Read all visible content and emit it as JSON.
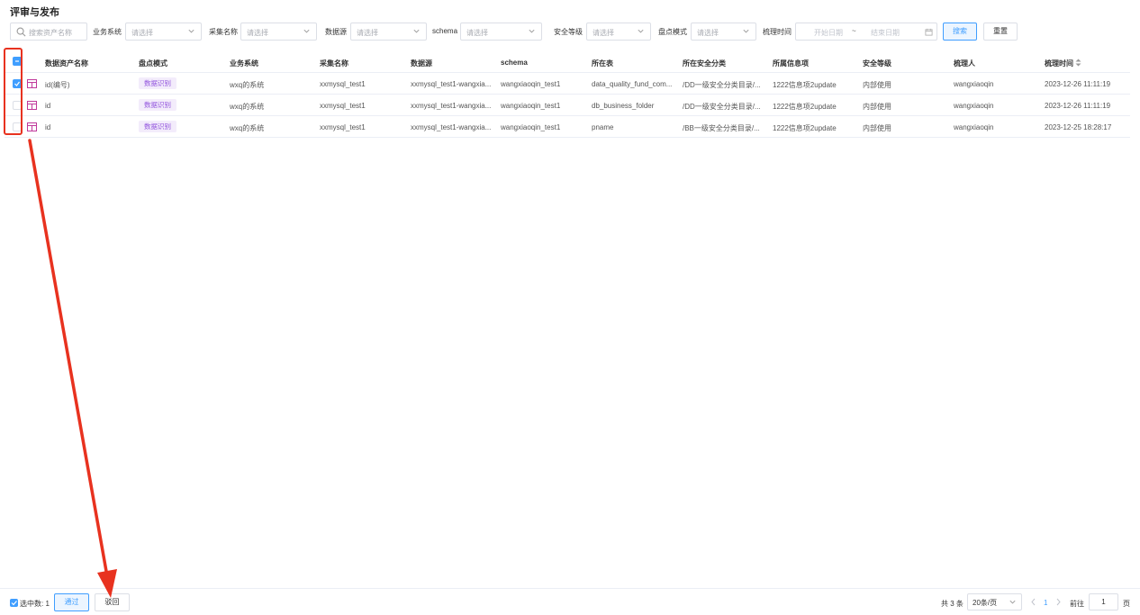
{
  "title": "评审与发布",
  "filters": {
    "search_placeholder": "搜索资产名称",
    "items": [
      {
        "label": "业务系统",
        "placeholder": "请选择"
      },
      {
        "label": "采集名称",
        "placeholder": "请选择"
      },
      {
        "label": "数据源",
        "placeholder": "请选择"
      },
      {
        "label": "schema",
        "placeholder": "请选择"
      },
      {
        "label": "安全等级",
        "placeholder": "请选择"
      },
      {
        "label": "盘点模式",
        "placeholder": "请选择"
      }
    ],
    "time_label": "梳理时间",
    "start_placeholder": "开始日期",
    "end_placeholder": "结束日期",
    "range_sep": "~",
    "search_button": "搜索",
    "reset_button": "重置"
  },
  "table": {
    "columns": [
      "数据资产名称",
      "盘点模式",
      "业务系统",
      "采集名称",
      "数据源",
      "schema",
      "所在表",
      "所在安全分类",
      "所属信息项",
      "安全等级",
      "梳理人",
      "梳理时间"
    ],
    "rows": [
      {
        "checked": true,
        "name": "id(编号)",
        "mode": "数据识别",
        "system": "wxq的系统",
        "collect": "xxmysql_test1",
        "source": "xxmysql_test1-wangxia...",
        "schema": "wangxiaoqin_test1",
        "table": "data_quality_fund_com...",
        "category": "/DD一级安全分类目录/...",
        "info": "1222信息项2update",
        "level": "内部使用",
        "owner": "wangxiaoqin",
        "time": "2023-12-26 11:11:19"
      },
      {
        "checked": false,
        "name": "id",
        "mode": "数据识别",
        "system": "wxq的系统",
        "collect": "xxmysql_test1",
        "source": "xxmysql_test1-wangxia...",
        "schema": "wangxiaoqin_test1",
        "table": "db_business_folder",
        "category": "/DD一级安全分类目录/...",
        "info": "1222信息项2update",
        "level": "内部使用",
        "owner": "wangxiaoqin",
        "time": "2023-12-26 11:11:19"
      },
      {
        "checked": false,
        "name": "id",
        "mode": "数据识别",
        "system": "wxq的系统",
        "collect": "xxmysql_test1",
        "source": "xxmysql_test1-wangxia...",
        "schema": "wangxiaoqin_test1",
        "table": "pname",
        "category": "/BB一级安全分类目录/...",
        "info": "1222信息项2update",
        "level": "内部使用",
        "owner": "wangxiaoqin",
        "time": "2023-12-25 18:28:17"
      }
    ]
  },
  "footer": {
    "selected_text": "选中数: 1",
    "pass_button": "通过",
    "reject_button": "驳回",
    "total_text": "共 3 条",
    "page_size": "20条/页",
    "current_page": "1",
    "goto_label": "前往",
    "goto_value": "1",
    "page_unit": "页"
  },
  "colors": {
    "accent": "#409eff",
    "annotation": "#e8321f",
    "tag": "#9254de"
  }
}
